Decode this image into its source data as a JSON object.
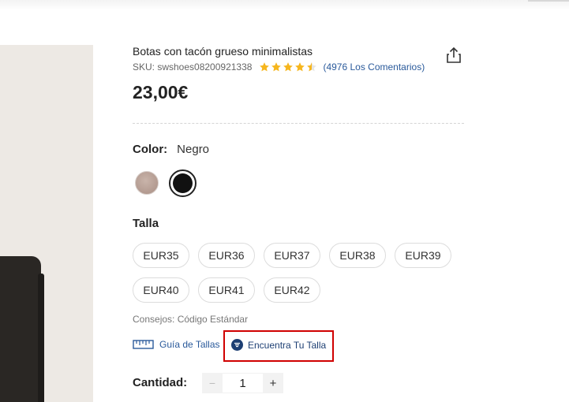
{
  "product": {
    "title": "Botas con tacón grueso minimalistas",
    "sku": "SKU: swshoes08200921338",
    "rating_stars": 4.5,
    "reviews_link": "(4976 Los Comentarios)",
    "price": "23,00€"
  },
  "color": {
    "label": "Color:",
    "selected": "Negro",
    "swatches": [
      {
        "name": "beige",
        "hex": "#b59c92"
      },
      {
        "name": "negro",
        "hex": "#111111"
      }
    ]
  },
  "size": {
    "label": "Talla",
    "options": [
      "EUR35",
      "EUR36",
      "EUR37",
      "EUR38",
      "EUR39",
      "EUR40",
      "EUR41",
      "EUR42"
    ],
    "tips": "Consejos: Código Estándar",
    "guide_link": "Guía de Tallas",
    "find_fit_link": "Encuentra Tu Talla"
  },
  "quantity": {
    "label": "Cantidad:",
    "value": "1",
    "minus": "−",
    "plus": "+"
  },
  "colors": {
    "link": "#2a5a9b",
    "star": "#f6b61e",
    "highlight": "#d00000",
    "fit_icon": "#1d3f73"
  },
  "icons": {
    "share": "share-icon",
    "ruler": "ruler-icon",
    "fit": "fit-finder-icon"
  }
}
